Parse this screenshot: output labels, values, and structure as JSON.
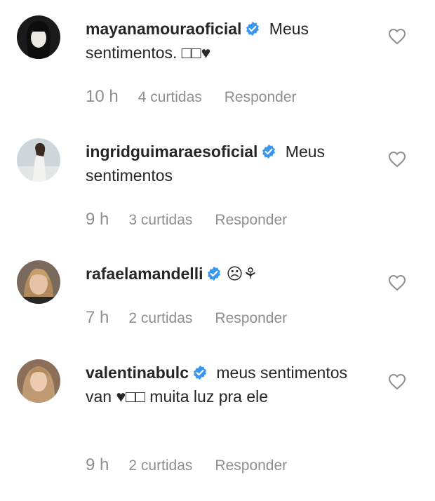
{
  "comments": [
    {
      "username": "mayanamouraoficial",
      "text": " Meus sentimentos. □□♥",
      "time": "10 h",
      "likes": "4 curtidas",
      "reply": "Responder"
    },
    {
      "username": "ingridguimaraesoficial",
      "text": " Meus sentimentos",
      "time": "9 h",
      "likes": "3 curtidas",
      "reply": "Responder"
    },
    {
      "username": "rafaelamandelli",
      "text": " ☹⚘",
      "time": "7 h",
      "likes": "2 curtidas",
      "reply": "Responder"
    },
    {
      "username": "valentinabulc",
      "text": " meus sentimentos van ♥□□ muita luz pra ele",
      "time": "9 h",
      "likes": "2 curtidas",
      "reply": "Responder"
    }
  ],
  "colors": {
    "text": "#262626",
    "muted": "#8e8e8e",
    "verified": "#3897f0"
  },
  "icons": {
    "verified": "verified-badge-icon",
    "like": "heart-outline-icon"
  }
}
